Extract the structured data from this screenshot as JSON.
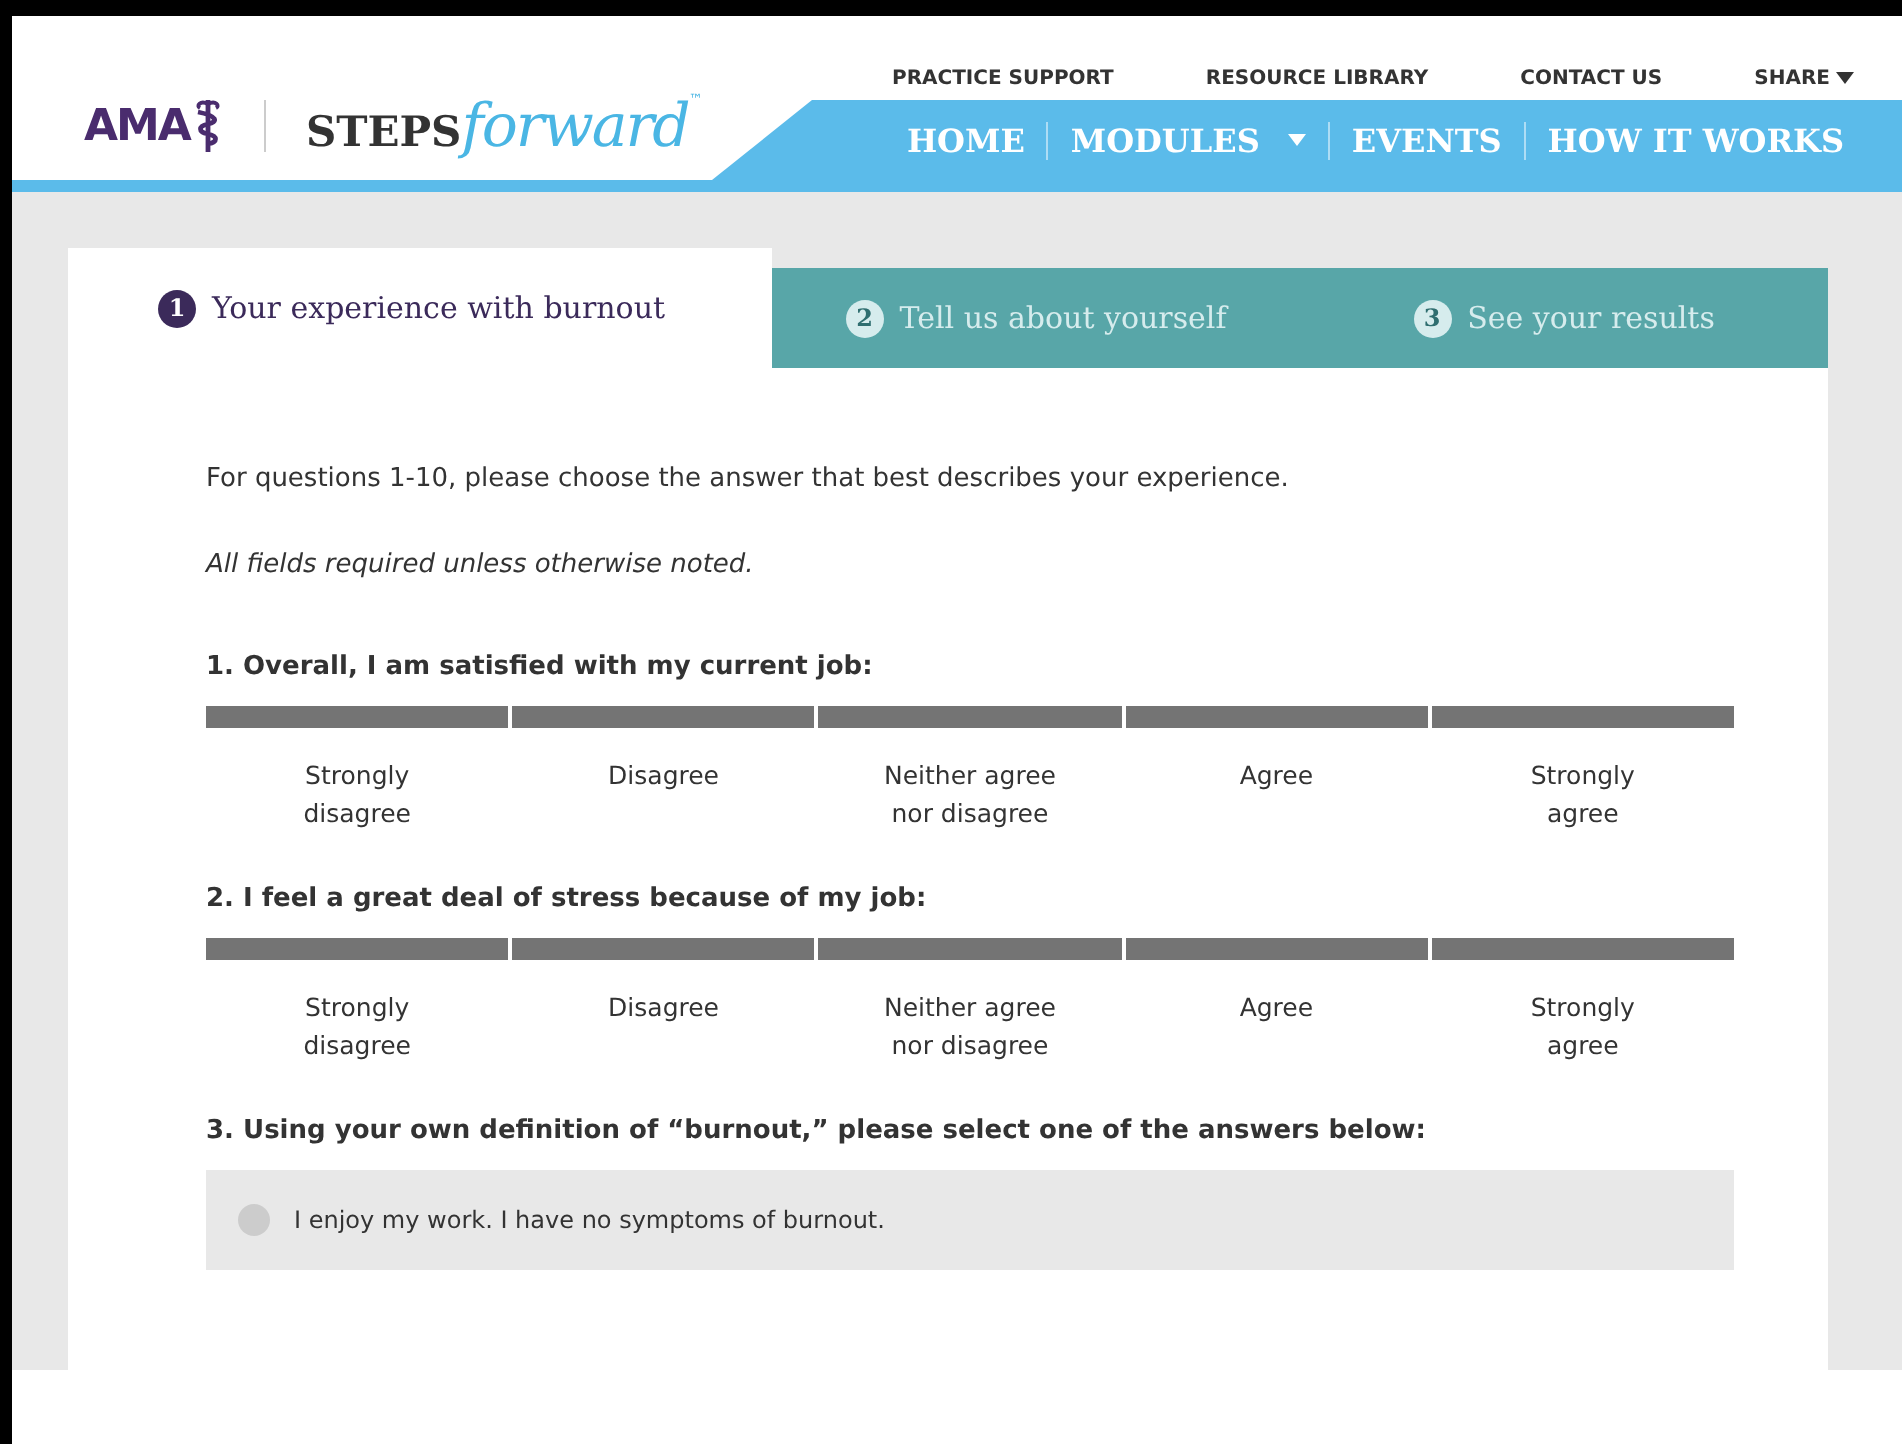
{
  "header": {
    "logo": {
      "org": "AMA",
      "brand_bold": "STEPS",
      "brand_italic": "forward",
      "trademark": "™"
    },
    "top_links": [
      {
        "label": "PRACTICE SUPPORT",
        "dropdown": false
      },
      {
        "label": "RESOURCE LIBRARY",
        "dropdown": false
      },
      {
        "label": "CONTACT US",
        "dropdown": false
      },
      {
        "label": "SHARE",
        "dropdown": true
      }
    ],
    "nav": [
      {
        "label": "HOME",
        "dropdown": false
      },
      {
        "label": "MODULES",
        "dropdown": true
      },
      {
        "label": "EVENTS",
        "dropdown": false
      },
      {
        "label": "HOW IT WORKS",
        "dropdown": false
      }
    ]
  },
  "steps": [
    {
      "number": "1",
      "label": "Your experience with burnout",
      "selected": true
    },
    {
      "number": "2",
      "label": "Tell us about yourself",
      "selected": false
    },
    {
      "number": "3",
      "label": "See your results",
      "selected": false
    }
  ],
  "intro": "For questions 1-10, please choose the answer that best describes your experience.",
  "note": "All fields required unless otherwise noted.",
  "questions": [
    {
      "kind": "scale",
      "text": "1. Overall, I am satisfied with my current job:",
      "options": [
        {
          "label": "Strongly disagree",
          "selected": false
        },
        {
          "label": "Disagree",
          "selected": false
        },
        {
          "label": "Neither agree nor disagree",
          "selected": false
        },
        {
          "label": "Agree",
          "selected": false
        },
        {
          "label": "Strongly agree",
          "selected": false
        }
      ]
    },
    {
      "kind": "scale",
      "text": "2. I feel a great deal of stress because of my job:",
      "options": [
        {
          "label": "Strongly disagree",
          "selected": false
        },
        {
          "label": "Disagree",
          "selected": false
        },
        {
          "label": "Neither agree nor disagree",
          "selected": false
        },
        {
          "label": "Agree",
          "selected": false
        },
        {
          "label": "Strongly agree",
          "selected": false
        }
      ]
    },
    {
      "kind": "radio",
      "text": "3. Using your own definition of “burnout,” please select one of the answers below:",
      "options": [
        {
          "label": "I enjoy my work. I have no symptoms of burnout.",
          "selected": false
        }
      ]
    }
  ]
}
